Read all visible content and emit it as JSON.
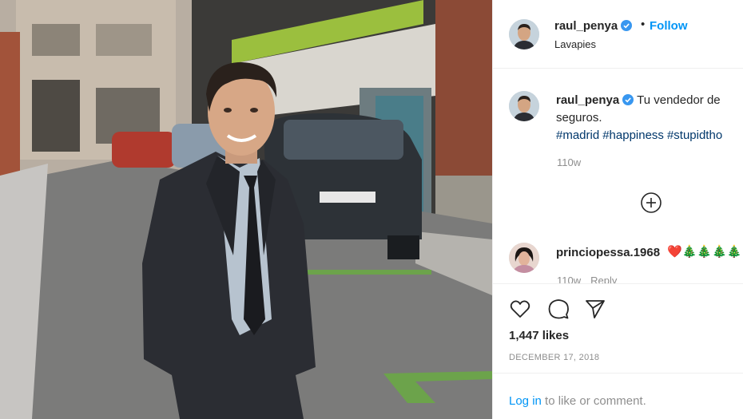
{
  "post": {
    "username": "raul_penya",
    "follow_label": "Follow",
    "separator": "•",
    "location": "Lavapies"
  },
  "caption": {
    "username": "raul_penya",
    "text_line1": "Tu vendedor de",
    "text_line2": "seguros.",
    "hashtags": [
      "#madrid",
      "#happiness",
      "#stupidtho"
    ],
    "time_ago": "110w"
  },
  "comments": [
    {
      "username": "princiopessa.1968",
      "text": "❤️🎄🎄🎄🎄",
      "time_ago": "110w",
      "reply_label": "Reply"
    }
  ],
  "actions": {
    "likes": "1,447 likes",
    "date": "DECEMBER 17, 2018"
  },
  "login": {
    "link_label": "Log in",
    "rest_text": " to like or comment."
  },
  "colors": {
    "link_blue": "#0095f6",
    "hashtag_blue": "#00376b",
    "muted": "#8e8e8e",
    "divider": "#efefef"
  },
  "icons": [
    "verified-badge-icon",
    "add-circle-icon",
    "heart-icon",
    "comment-icon",
    "share-icon",
    "heart-emoji",
    "christmas-tree-emoji"
  ]
}
